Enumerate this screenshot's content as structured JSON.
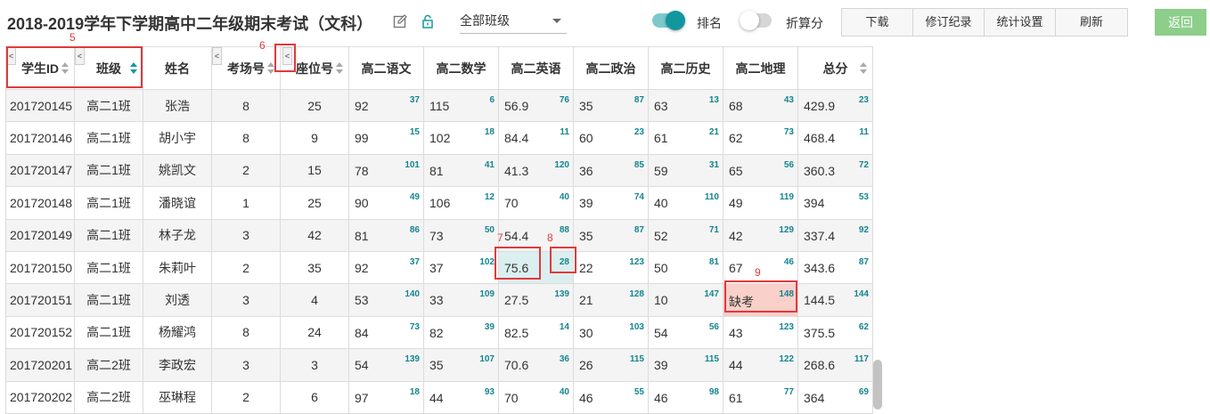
{
  "header": {
    "title": "2018-2019学年下学期高中二年级期末考试（文科）",
    "class_select": "全部班级",
    "toggle_rank": {
      "label": "排名",
      "on": true
    },
    "toggle_convert": {
      "label": "折算分",
      "on": false
    },
    "buttons": [
      "下载",
      "修订纪录",
      "统计设置",
      "刷新"
    ],
    "return_label": "返回"
  },
  "columns": [
    "学生ID",
    "班级",
    "姓名",
    "考场号",
    "座位号",
    "高二语文",
    "高二数学",
    "高二英语",
    "高二政治",
    "高二历史",
    "高二地理",
    "总分"
  ],
  "rows": [
    {
      "id": "201720145",
      "cls": "高二1班",
      "name": "张浩",
      "room": "8",
      "seat": "25",
      "s": [
        [
          "92",
          "37"
        ],
        [
          "115",
          "6"
        ],
        [
          "56.9",
          "76"
        ],
        [
          "35",
          "87"
        ],
        [
          "63",
          "13"
        ],
        [
          "68",
          "43"
        ]
      ],
      "total": [
        "429.9",
        "23"
      ]
    },
    {
      "id": "201720146",
      "cls": "高二1班",
      "name": "胡小宇",
      "room": "8",
      "seat": "9",
      "s": [
        [
          "99",
          "15"
        ],
        [
          "102",
          "18"
        ],
        [
          "84.4",
          "11"
        ],
        [
          "60",
          "23"
        ],
        [
          "61",
          "21"
        ],
        [
          "62",
          "73"
        ]
      ],
      "total": [
        "468.4",
        "11"
      ]
    },
    {
      "id": "201720147",
      "cls": "高二1班",
      "name": "姚凯文",
      "room": "2",
      "seat": "15",
      "s": [
        [
          "78",
          "101"
        ],
        [
          "81",
          "41"
        ],
        [
          "41.3",
          "120"
        ],
        [
          "36",
          "85"
        ],
        [
          "59",
          "31"
        ],
        [
          "65",
          "56"
        ]
      ],
      "total": [
        "360.3",
        "72"
      ]
    },
    {
      "id": "201720148",
      "cls": "高二1班",
      "name": "潘晓谊",
      "room": "1",
      "seat": "25",
      "s": [
        [
          "90",
          "49"
        ],
        [
          "106",
          "12"
        ],
        [
          "70",
          "40"
        ],
        [
          "39",
          "74"
        ],
        [
          "40",
          "110"
        ],
        [
          "49",
          "119"
        ]
      ],
      "total": [
        "394",
        "53"
      ]
    },
    {
      "id": "201720149",
      "cls": "高二1班",
      "name": "林子龙",
      "room": "3",
      "seat": "42",
      "s": [
        [
          "81",
          "86"
        ],
        [
          "73",
          "50"
        ],
        [
          "54.4",
          "88"
        ],
        [
          "35",
          "87"
        ],
        [
          "52",
          "71"
        ],
        [
          "42",
          "129"
        ]
      ],
      "total": [
        "337.4",
        "92"
      ]
    },
    {
      "id": "201720150",
      "cls": "高二1班",
      "name": "朱莉叶",
      "room": "2",
      "seat": "35",
      "s": [
        [
          "92",
          "37"
        ],
        [
          "37",
          "102"
        ],
        [
          "75.6",
          "28"
        ],
        [
          "22",
          "123"
        ],
        [
          "50",
          "81"
        ],
        [
          "67",
          "46"
        ]
      ],
      "total": [
        "343.6",
        "87"
      ]
    },
    {
      "id": "201720151",
      "cls": "高二1班",
      "name": "刘透",
      "room": "3",
      "seat": "4",
      "s": [
        [
          "53",
          "140"
        ],
        [
          "33",
          "109"
        ],
        [
          "27.5",
          "139"
        ],
        [
          "21",
          "128"
        ],
        [
          "10",
          "147"
        ],
        [
          "缺考",
          "148"
        ]
      ],
      "total": [
        "144.5",
        "144"
      ]
    },
    {
      "id": "201720152",
      "cls": "高二1班",
      "name": "杨耀鸿",
      "room": "8",
      "seat": "24",
      "s": [
        [
          "84",
          "73"
        ],
        [
          "82",
          "39"
        ],
        [
          "82.5",
          "14"
        ],
        [
          "30",
          "103"
        ],
        [
          "54",
          "56"
        ],
        [
          "43",
          "123"
        ]
      ],
      "total": [
        "375.5",
        "62"
      ]
    },
    {
      "id": "201720201",
      "cls": "高二2班",
      "name": "李政宏",
      "room": "3",
      "seat": "3",
      "s": [
        [
          "54",
          "139"
        ],
        [
          "35",
          "107"
        ],
        [
          "70.6",
          "36"
        ],
        [
          "26",
          "115"
        ],
        [
          "39",
          "115"
        ],
        [
          "44",
          "122"
        ]
      ],
      "total": [
        "268.6",
        "117"
      ]
    },
    {
      "id": "201720202",
      "cls": "高二2班",
      "name": "巫琳程",
      "room": "2",
      "seat": "6",
      "s": [
        [
          "97",
          "18"
        ],
        [
          "44",
          "93"
        ],
        [
          "70",
          "40"
        ],
        [
          "46",
          "55"
        ],
        [
          "46",
          "98"
        ],
        [
          "61",
          "77"
        ]
      ],
      "total": [
        "364",
        "69"
      ]
    }
  ],
  "annotations": [
    "5",
    "6",
    "7",
    "8",
    "9"
  ],
  "colors": {
    "accent": "#13979f",
    "rank": "#14858f",
    "annotation": "#e2393c",
    "missing_bg": "#f9d0ca",
    "highlight_bg": "#dbeff0",
    "return_bg": "#8dce8a"
  }
}
